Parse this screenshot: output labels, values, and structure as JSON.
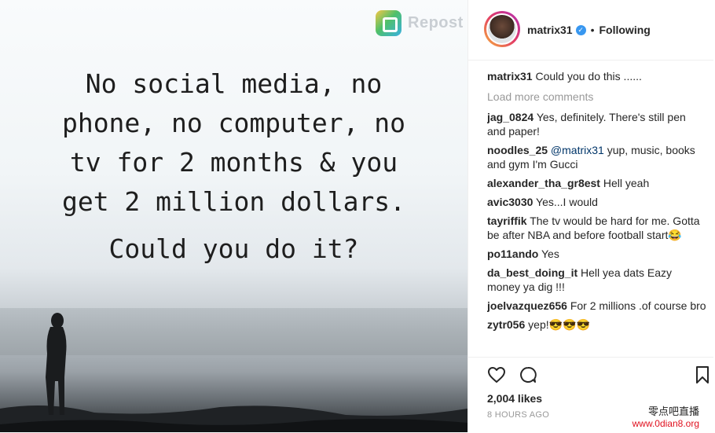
{
  "image": {
    "repost_label": "Repost",
    "lines": [
      "No social media, no",
      "phone, no computer, no",
      "tv for 2 months & you",
      "get 2 million dollars."
    ],
    "question": "Could you do it?"
  },
  "header": {
    "username": "matrix31",
    "verified_mark": "✓",
    "separator": "•",
    "follow_state": "Following"
  },
  "caption": {
    "user": "matrix31",
    "text": "Could you do this ......"
  },
  "load_more": "Load more comments",
  "comments": [
    {
      "user": "jag_0824",
      "text": "Yes, definitely. There's still pen and paper!"
    },
    {
      "user": "noodles_25",
      "mention": "@matrix31",
      "text": "yup, music, books and gym I'm Gucci"
    },
    {
      "user": "alexander_tha_gr8est",
      "text": "Hell yeah"
    },
    {
      "user": "avic3030",
      "text": "Yes...I would"
    },
    {
      "user": "tayriffik",
      "text": "The tv would be hard for me. Gotta be after NBA and before football start😂"
    },
    {
      "user": "po11ando",
      "text": "Yes"
    },
    {
      "user": "da_best_doing_it",
      "text": "Hell yea dats Eazy money ya dig !!!"
    },
    {
      "user": "joelvazquez656",
      "text": "For 2 millions .of course bro"
    },
    {
      "user": "zytr056",
      "text": "yep!😎😎😎"
    }
  ],
  "likes": "2,004 likes",
  "time": "8 HOURS AGO",
  "watermark": {
    "line1": "零点吧直播",
    "line2": "www.0dian8.org"
  },
  "colors": {
    "link": "#003569",
    "muted": "#999999",
    "verified": "#3897f0"
  },
  "icons": [
    "heart-icon",
    "comment-icon",
    "bookmark-icon",
    "repost-icon",
    "verified-icon"
  ]
}
